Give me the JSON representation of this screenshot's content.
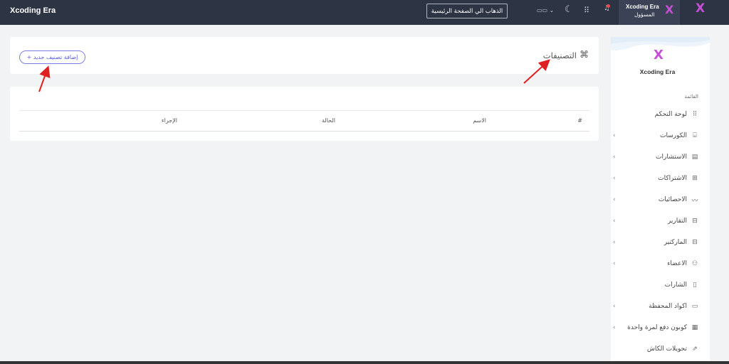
{
  "topbar": {
    "brand": "Xcoding Era",
    "home_button": "الذهاب الي الصفحة الرئيسية",
    "profile_name": "Xcoding Era",
    "profile_role": "المسؤول",
    "logo_letter": "X",
    "icons": [
      "language-flag-icon",
      "moon-icon",
      "apps-grid-icon",
      "bell-icon"
    ]
  },
  "page": {
    "title": "التصنيفات",
    "title_icon": "⌘",
    "add_button": "+ إضافة تصنيف جديد"
  },
  "table": {
    "columns": [
      "#",
      "الاسم",
      "الحالة",
      "الإجراء"
    ]
  },
  "sidebar": {
    "brand": "Xcoding Era",
    "logo_letter": "X",
    "heading": "القائمة",
    "items": [
      {
        "label": "لوحة التحكم",
        "icon": "⠿",
        "arrow": ""
      },
      {
        "label": "الكورسات",
        "icon": "⌸",
        "arrow": "‹"
      },
      {
        "label": "الاستشارات",
        "icon": "▤",
        "arrow": "‹"
      },
      {
        "label": "الاشتراكات",
        "icon": "⊞",
        "arrow": "‹"
      },
      {
        "label": "الاحصائيات",
        "icon": "〰",
        "arrow": "‹"
      },
      {
        "label": "التقارير",
        "icon": "⊟",
        "arrow": "‹"
      },
      {
        "label": "الماركتير",
        "icon": "⊟",
        "arrow": "‹"
      },
      {
        "label": "الاعضاء",
        "icon": "⚇",
        "arrow": "‹"
      },
      {
        "label": "الشارات",
        "icon": "▯",
        "arrow": ""
      },
      {
        "label": "اكواد المحفظة",
        "icon": "▭",
        "arrow": "‹"
      },
      {
        "label": "كوبون دفع لمرة واحدة",
        "icon": "▦",
        "arrow": "‹"
      },
      {
        "label": "تحويلات الكاش",
        "icon": "⇗",
        "arrow": ""
      }
    ]
  },
  "colors": {
    "topbar": "#2d3444",
    "accent": "#5a5fd8",
    "logo": "#c64fd6",
    "annotation_arrow": "#e02020"
  }
}
